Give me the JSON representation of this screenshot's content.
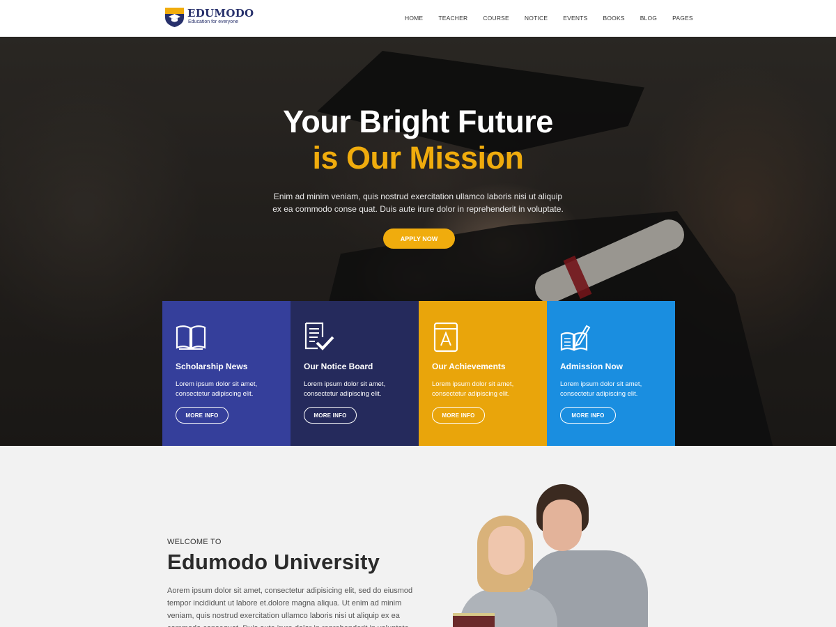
{
  "brand": {
    "name": "EDUMODO",
    "tagline": "Education for everyone",
    "colors": {
      "navy": "#27306b",
      "gold": "#f0ac0d"
    }
  },
  "nav": {
    "items": [
      "HOME",
      "TEACHER",
      "COURSE",
      "NOTICE",
      "EVENTS",
      "BOOKS",
      "BLOG",
      "PAGES"
    ]
  },
  "hero": {
    "title_line1": "Your Bright Future",
    "title_line2": "is Our Mission",
    "text": "Enim ad minim veniam, quis nostrud exercitation ullamco laboris nisi ut aliquip ex ea commodo conse quat. Duis aute irure dolor in reprehenderit in voluptate.",
    "cta_label": "APPLY NOW"
  },
  "features": [
    {
      "title": "Scholarship News",
      "text": "Lorem ipsum dolor sit amet, consectetur adipiscing elit.",
      "button": "MORE INFO",
      "icon": "open-book-icon",
      "color": "#353f9b"
    },
    {
      "title": "Our Notice Board",
      "text": "Lorem ipsum dolor sit amet, consectetur adipiscing elit.",
      "button": "MORE INFO",
      "icon": "document-check-icon",
      "color": "#252a5c"
    },
    {
      "title": "Our Achievements",
      "text": "Lorem ipsum dolor sit amet, consectetur adipiscing elit.",
      "button": "MORE INFO",
      "icon": "book-a-icon",
      "color": "#e9a50b"
    },
    {
      "title": "Admission Now",
      "text": "Lorem ipsum dolor sit amet, consectetur adipiscing elit.",
      "button": "MORE INFO",
      "icon": "book-pencil-icon",
      "color": "#1a8ee0"
    }
  ],
  "welcome": {
    "kicker": "WELCOME TO",
    "title": "Edumodo University",
    "text": "Aorem ipsum dolor sit amet, consectetur adipisicing elit, sed do eiusmod tempor incididunt ut labore et.dolore magna aliqua. Ut enim ad minim veniam, quis nostrud exercitation ullamco laboris nisi ut aliquip ex ea commodo consequat. Duis aute irure dolor in reprehenderit in voluptate"
  }
}
